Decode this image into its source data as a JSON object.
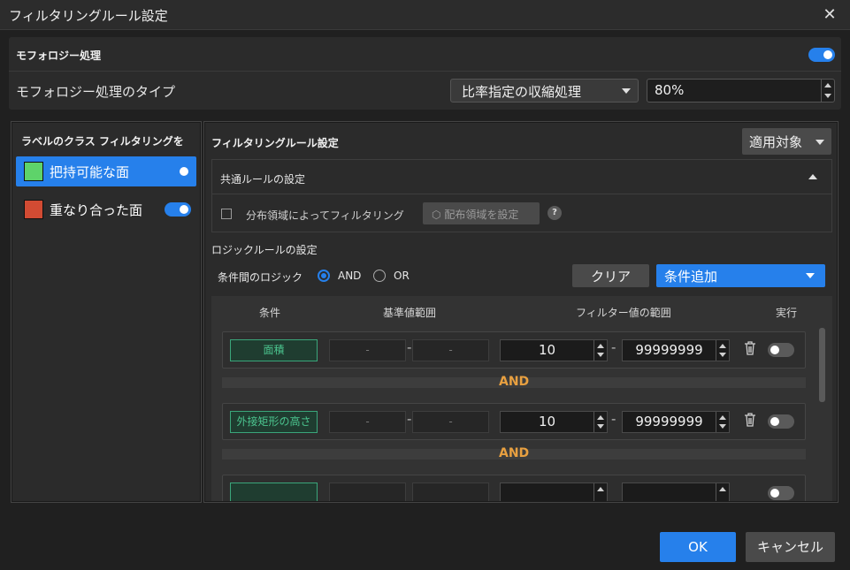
{
  "window": {
    "title": "フィルタリングルール設定",
    "close_icon": "close-icon"
  },
  "morphology": {
    "title": "モフォロジー処理",
    "enabled": true,
    "type_label": "モフォロジー処理のタイプ",
    "type_value": "比率指定の収縮処理",
    "percent_value": "80%"
  },
  "left_panel": {
    "title": "ラベルのクラス フィルタリングを",
    "classes": [
      {
        "label": "把持可能な面",
        "color": "#5ed36a",
        "selected": true,
        "enabled": true
      },
      {
        "label": "重なり合った面",
        "color": "#d24b33",
        "selected": false,
        "enabled": true
      }
    ]
  },
  "right_panel": {
    "title": "フィルタリングルール設定",
    "apply_target_label": "適用対象",
    "common": {
      "title": "共通ルールの設定",
      "dist_checkbox_label": "分布領域によってフィルタリング",
      "dist_button_label": "配布領域を設定",
      "help_label": "?"
    },
    "logic": {
      "title": "ロジックルールの設定",
      "between_label": "条件間のロジック",
      "options": [
        "AND",
        "OR"
      ],
      "selected": "AND",
      "clear_label": "クリア",
      "add_label": "条件追加"
    },
    "table": {
      "headers": [
        "条件",
        "基準値範囲",
        "フィルター値の範囲",
        "実行"
      ],
      "connector": "AND",
      "rules": [
        {
          "condition": "面積",
          "ref_min": "-",
          "ref_max": "-",
          "min": "10",
          "max": "99999999",
          "run": false
        },
        {
          "condition": "外接矩形の高さ",
          "ref_min": "-",
          "ref_max": "-",
          "min": "10",
          "max": "99999999",
          "run": false
        },
        {
          "condition": "",
          "ref_min": "",
          "ref_max": "",
          "min": "",
          "max": "",
          "run": false
        }
      ]
    }
  },
  "footer": {
    "ok_label": "OK",
    "cancel_label": "キャンセル"
  }
}
